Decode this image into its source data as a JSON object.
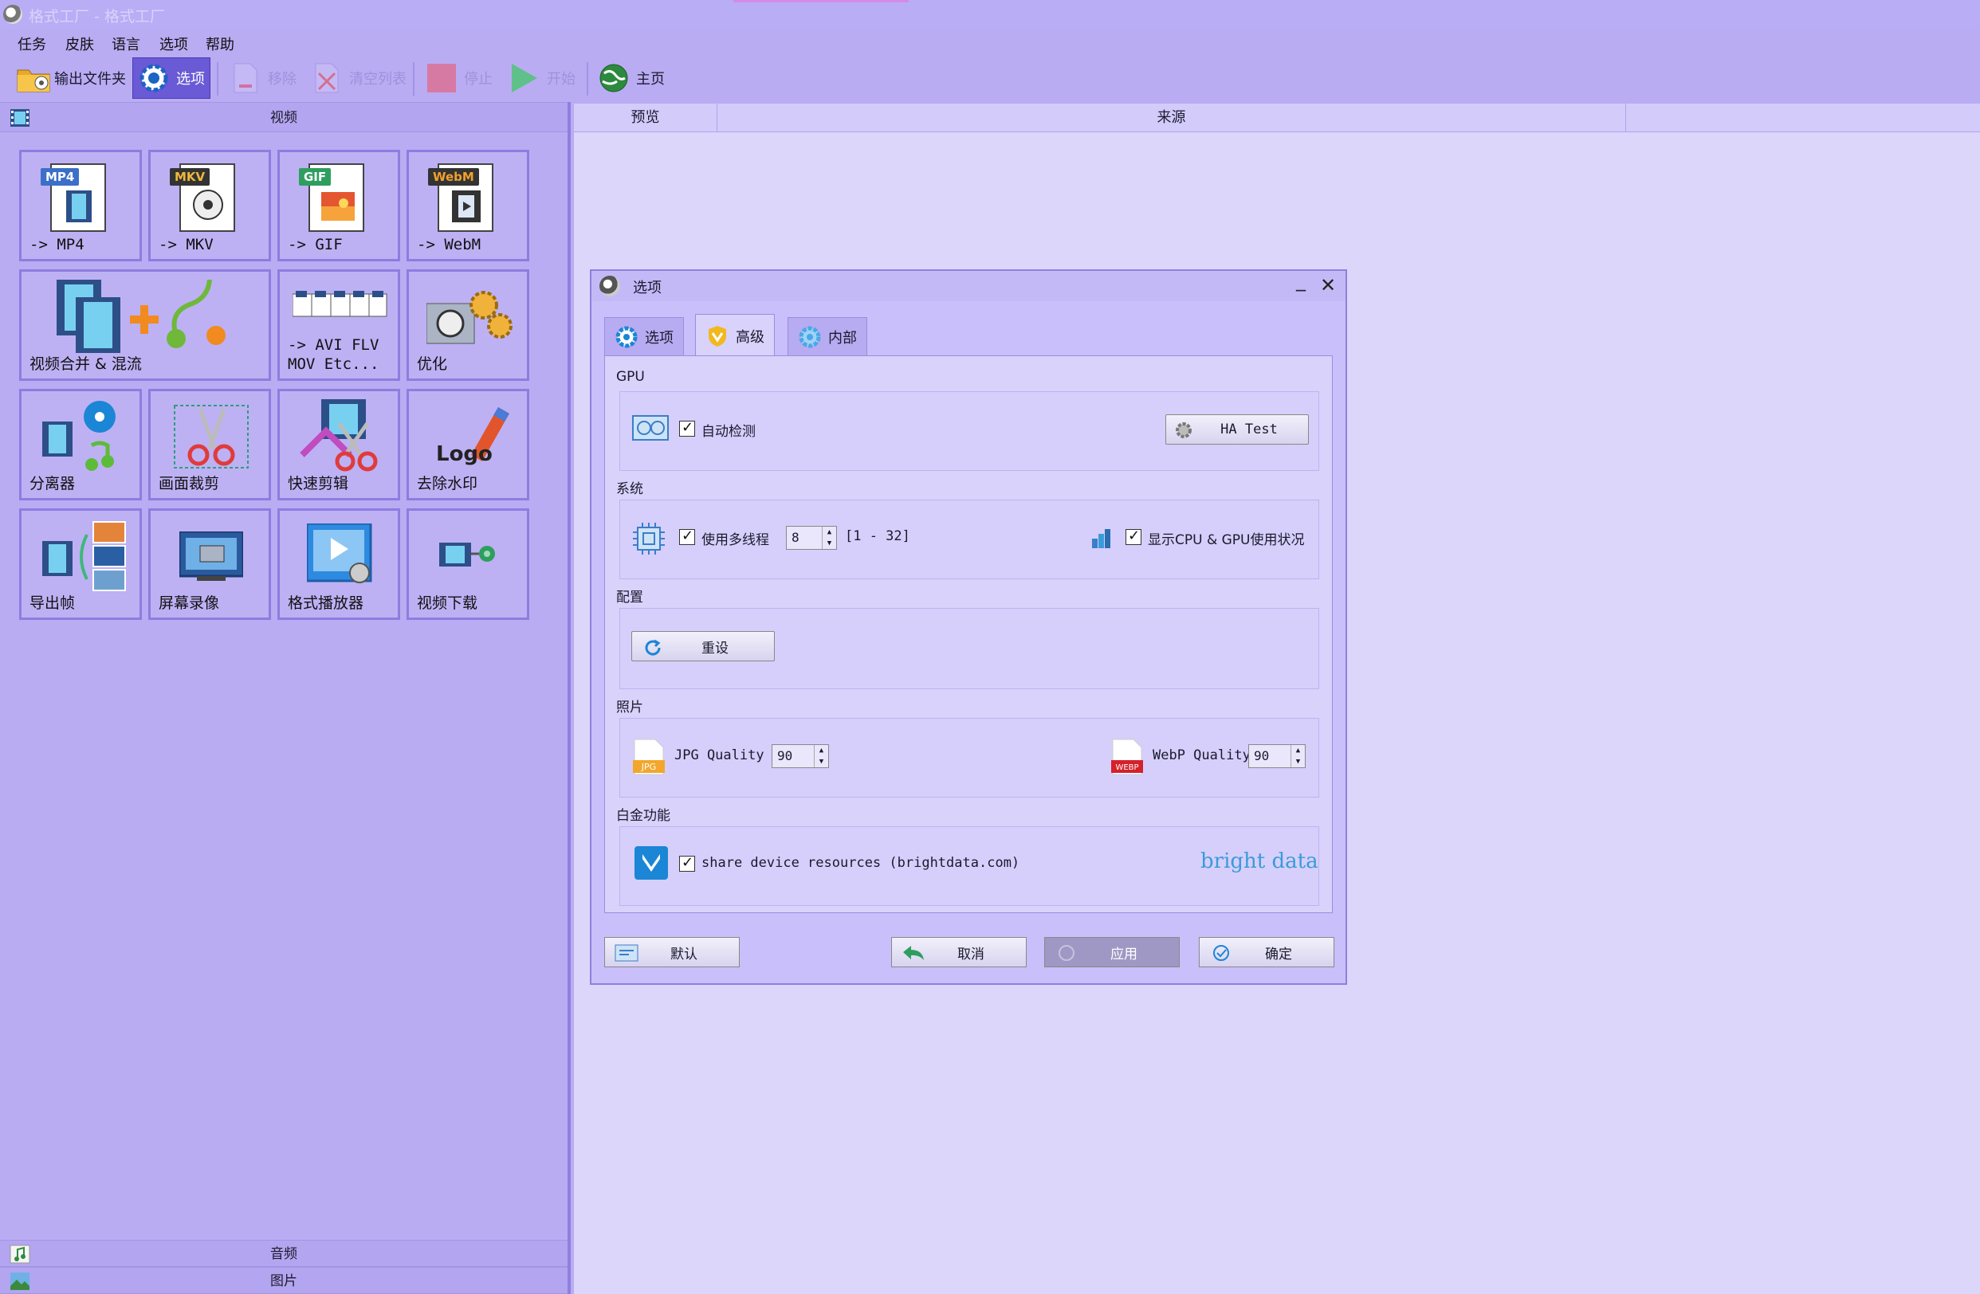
{
  "window": {
    "title": "格式工厂 - 格式工厂"
  },
  "menu": [
    "任务",
    "皮肤",
    "语言",
    "选项",
    "帮助"
  ],
  "toolbar": {
    "output_folder": "输出文件夹",
    "options": "选项",
    "remove": "移除",
    "clear_list": "清空列表",
    "stop": "停止",
    "start": "开始",
    "home": "主页"
  },
  "left_panel": {
    "video_header": "视频",
    "audio_header": "音频",
    "picture_header": "图片",
    "tiles": [
      {
        "label": "-> MP4",
        "tag": "MP4"
      },
      {
        "label": "-> MKV",
        "tag": "MKV"
      },
      {
        "label": "-> GIF",
        "tag": "GIF"
      },
      {
        "label": "-> WebM",
        "tag": "WebM"
      },
      {
        "label": "视频合并 & 混流"
      },
      {
        "label": "-> AVI FLV\nMOV Etc..."
      },
      {
        "label": "优化"
      },
      {
        "label": "分离器"
      },
      {
        "label": "画面裁剪"
      },
      {
        "label": "快速剪辑"
      },
      {
        "label": "去除水印",
        "logo": "Logo"
      },
      {
        "label": "导出帧"
      },
      {
        "label": "屏幕录像"
      },
      {
        "label": "格式播放器"
      },
      {
        "label": "视频下载"
      }
    ]
  },
  "list_columns": [
    "预览",
    "来源"
  ],
  "dialog": {
    "title": "选项",
    "tabs": [
      "选项",
      "高级",
      "内部"
    ],
    "active_tab": 1,
    "gpu": {
      "label": "GPU",
      "auto_detect": "自动检测",
      "auto_detect_checked": true,
      "ha_test": "HA Test"
    },
    "system": {
      "label": "系统",
      "multithread": "使用多线程",
      "multithread_checked": true,
      "threads": "8",
      "range": "[1 - 32]",
      "show_usage": "显示CPU & GPU使用状况",
      "show_usage_checked": true
    },
    "config": {
      "label": "配置",
      "reset": "重设"
    },
    "photo": {
      "label": "照片",
      "jpg_quality_label": "JPG Quality",
      "jpg_quality": "90",
      "jpg_icon_text": "JPG",
      "webp_quality_label": "WebP Quality",
      "webp_quality": "90",
      "webp_icon_text": "WEBP"
    },
    "platinum": {
      "label": "白金功能",
      "share": "share device resources (brightdata.com)",
      "share_checked": true,
      "brand": "bright data"
    },
    "buttons": {
      "default": "默认",
      "cancel": "取消",
      "apply": "应用",
      "ok": "确定"
    }
  },
  "colors": {
    "background": "#b9acf2",
    "accent": "#6a5ad6",
    "dialog_bg": "#d9d2fb",
    "brightdata_blue": "#3a9bd9"
  }
}
